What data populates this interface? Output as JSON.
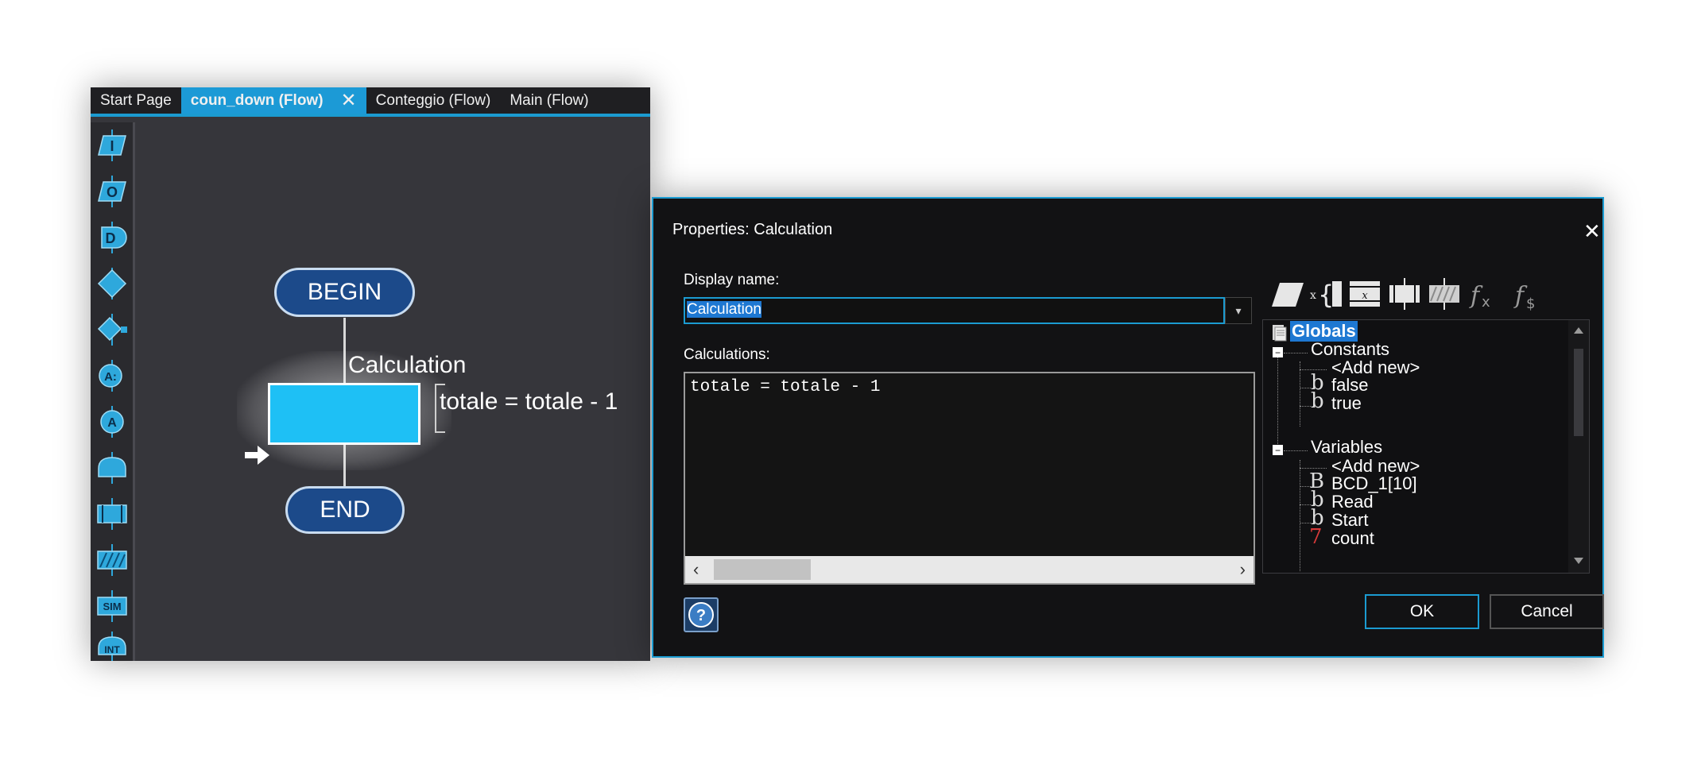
{
  "editor": {
    "tabs": [
      {
        "label": "Start Page"
      },
      {
        "label": "coun_down (Flow)",
        "close": "✕"
      },
      {
        "label": "Conteggio (Flow)"
      },
      {
        "label": "Main (Flow)"
      }
    ],
    "toolbox": {
      "items": [
        "input-icon",
        "output-icon",
        "delay-icon",
        "decision-icon",
        "loop-icon",
        "connection-point-icon",
        "connector-icon",
        "component-macro-icon",
        "macro-icon",
        "calculation-icon",
        "simulation-icon",
        "interrupt-icon"
      ],
      "labels": {
        "input": "I",
        "output": "O",
        "delay": "D",
        "connpoint": "A:",
        "connector": "A",
        "sim": "SIM",
        "int": "INT"
      }
    },
    "flow": {
      "begin_label": "BEGIN",
      "end_label": "END",
      "calc_title": "Calculation",
      "calc_comment": "totale = totale - 1"
    },
    "colors": {
      "accent": "#1b9bd1",
      "calc_fill": "#1ec0f5",
      "terminator_fill": "#1c4a8a"
    }
  },
  "dialog": {
    "title": "Properties: Calculation",
    "close": "✕",
    "display_name_label": "Display name:",
    "display_name_value": "Calculation",
    "calculations_label": "Calculations:",
    "calculations_text": "totale = totale - 1",
    "ok_label": "OK",
    "cancel_label": "Cancel",
    "tree": {
      "root": "Globals",
      "constants": {
        "label": "Constants",
        "add_new": "<Add new>",
        "items": [
          "false",
          "true"
        ]
      },
      "variables": {
        "label": "Variables",
        "add_new": "<Add new>",
        "items": [
          "BCD_1[10]",
          "Read",
          "Start",
          "count"
        ]
      }
    }
  }
}
